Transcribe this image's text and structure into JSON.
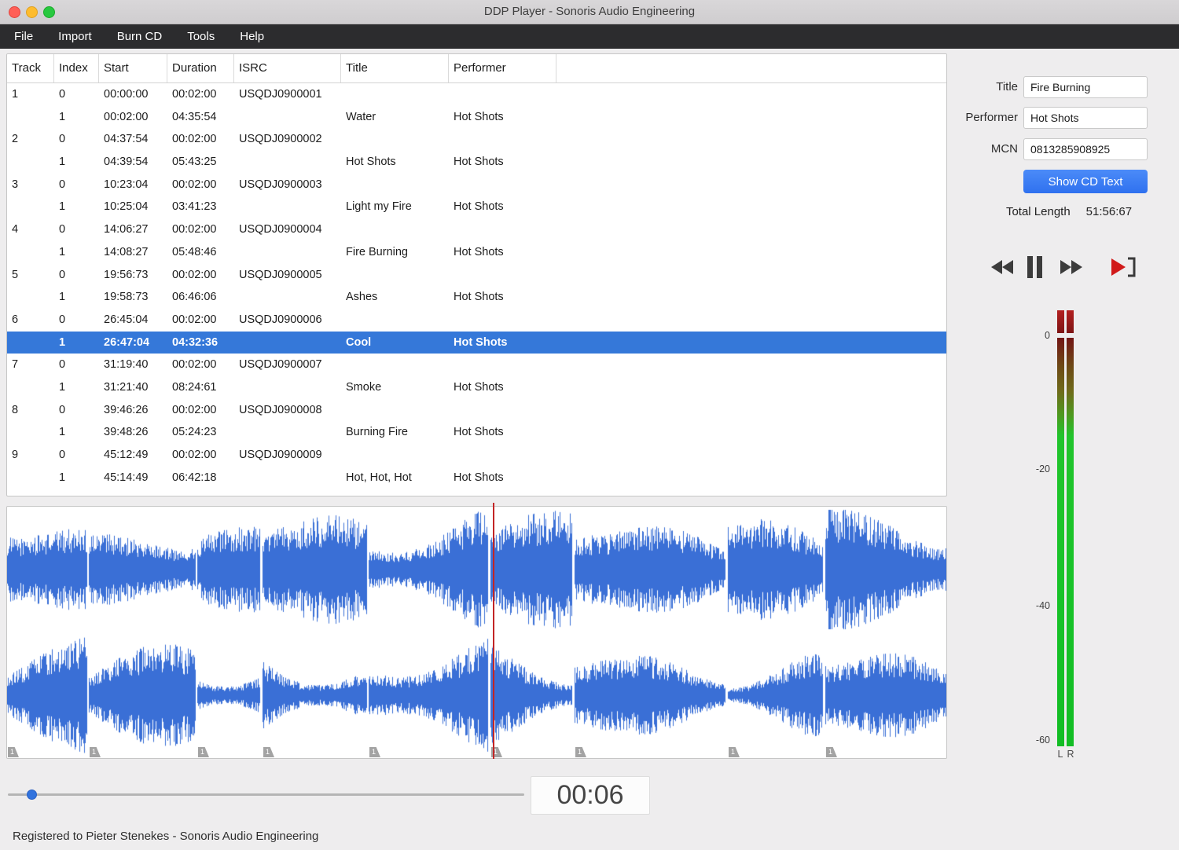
{
  "window": {
    "title": "DDP Player - Sonoris Audio Engineering"
  },
  "menu": {
    "items": [
      "File",
      "Import",
      "Burn CD",
      "Tools",
      "Help"
    ]
  },
  "table": {
    "columns": [
      "Track",
      "Index",
      "Start",
      "Duration",
      "ISRC",
      "Title",
      "Performer"
    ],
    "rows": [
      {
        "track": "1",
        "index": "0",
        "start": "00:00:00",
        "duration": "00:02:00",
        "isrc": "USQDJ0900001",
        "title": "",
        "performer": "",
        "selected": false
      },
      {
        "track": "",
        "index": "1",
        "start": "00:02:00",
        "duration": "04:35:54",
        "isrc": "",
        "title": "Water",
        "performer": "Hot Shots",
        "selected": false
      },
      {
        "track": "2",
        "index": "0",
        "start": "04:37:54",
        "duration": "00:02:00",
        "isrc": "USQDJ0900002",
        "title": "",
        "performer": "",
        "selected": false
      },
      {
        "track": "",
        "index": "1",
        "start": "04:39:54",
        "duration": "05:43:25",
        "isrc": "",
        "title": "Hot Shots",
        "performer": "Hot Shots",
        "selected": false
      },
      {
        "track": "3",
        "index": "0",
        "start": "10:23:04",
        "duration": "00:02:00",
        "isrc": "USQDJ0900003",
        "title": "",
        "performer": "",
        "selected": false
      },
      {
        "track": "",
        "index": "1",
        "start": "10:25:04",
        "duration": "03:41:23",
        "isrc": "",
        "title": "Light my Fire",
        "performer": "Hot Shots",
        "selected": false
      },
      {
        "track": "4",
        "index": "0",
        "start": "14:06:27",
        "duration": "00:02:00",
        "isrc": "USQDJ0900004",
        "title": "",
        "performer": "",
        "selected": false
      },
      {
        "track": "",
        "index": "1",
        "start": "14:08:27",
        "duration": "05:48:46",
        "isrc": "",
        "title": "Fire Burning",
        "performer": "Hot Shots",
        "selected": false
      },
      {
        "track": "5",
        "index": "0",
        "start": "19:56:73",
        "duration": "00:02:00",
        "isrc": "USQDJ0900005",
        "title": "",
        "performer": "",
        "selected": false
      },
      {
        "track": "",
        "index": "1",
        "start": "19:58:73",
        "duration": "06:46:06",
        "isrc": "",
        "title": "Ashes",
        "performer": "Hot Shots",
        "selected": false
      },
      {
        "track": "6",
        "index": "0",
        "start": "26:45:04",
        "duration": "00:02:00",
        "isrc": "USQDJ0900006",
        "title": "",
        "performer": "",
        "selected": false
      },
      {
        "track": "",
        "index": "1",
        "start": "26:47:04",
        "duration": "04:32:36",
        "isrc": "",
        "title": "Cool",
        "performer": "Hot Shots",
        "selected": true
      },
      {
        "track": "7",
        "index": "0",
        "start": "31:19:40",
        "duration": "00:02:00",
        "isrc": "USQDJ0900007",
        "title": "",
        "performer": "",
        "selected": false
      },
      {
        "track": "",
        "index": "1",
        "start": "31:21:40",
        "duration": "08:24:61",
        "isrc": "",
        "title": "Smoke",
        "performer": "Hot Shots",
        "selected": false
      },
      {
        "track": "8",
        "index": "0",
        "start": "39:46:26",
        "duration": "00:02:00",
        "isrc": "USQDJ0900008",
        "title": "",
        "performer": "",
        "selected": false
      },
      {
        "track": "",
        "index": "1",
        "start": "39:48:26",
        "duration": "05:24:23",
        "isrc": "",
        "title": "Burning Fire",
        "performer": "Hot Shots",
        "selected": false
      },
      {
        "track": "9",
        "index": "0",
        "start": "45:12:49",
        "duration": "00:02:00",
        "isrc": "USQDJ0900009",
        "title": "",
        "performer": "",
        "selected": false
      },
      {
        "track": "",
        "index": "1",
        "start": "45:14:49",
        "duration": "06:42:18",
        "isrc": "",
        "title": "Hot, Hot, Hot",
        "performer": "Hot Shots",
        "selected": false
      }
    ]
  },
  "side": {
    "title_label": "Title",
    "title_value": "Fire Burning",
    "performer_label": "Performer",
    "performer_value": "Hot Shots",
    "mcn_label": "MCN",
    "mcn_value": "0813285908925",
    "show_cd_text_label": "Show CD Text",
    "total_length_label": "Total Length",
    "total_length_value": "51:56:67",
    "transport_icons": [
      "rewind",
      "pause",
      "fast-forward",
      "play-to-marker"
    ],
    "meter": {
      "ticks": [
        "0",
        "-20",
        "-40",
        "-60"
      ],
      "channels": [
        "L",
        "R"
      ]
    }
  },
  "waveform": {
    "marker_label": "1"
  },
  "timeline": {
    "time": "00:06"
  },
  "status": {
    "text": "Registered to Pieter Stenekes - Sonoris Audio Engineering"
  },
  "colors": {
    "selection": "#3578d9",
    "button_blue": "#377df6",
    "waveform": "#3a6fd6",
    "playhead": "#c32525",
    "meter_green": "#1ec42b",
    "meter_red": "#b32020"
  }
}
